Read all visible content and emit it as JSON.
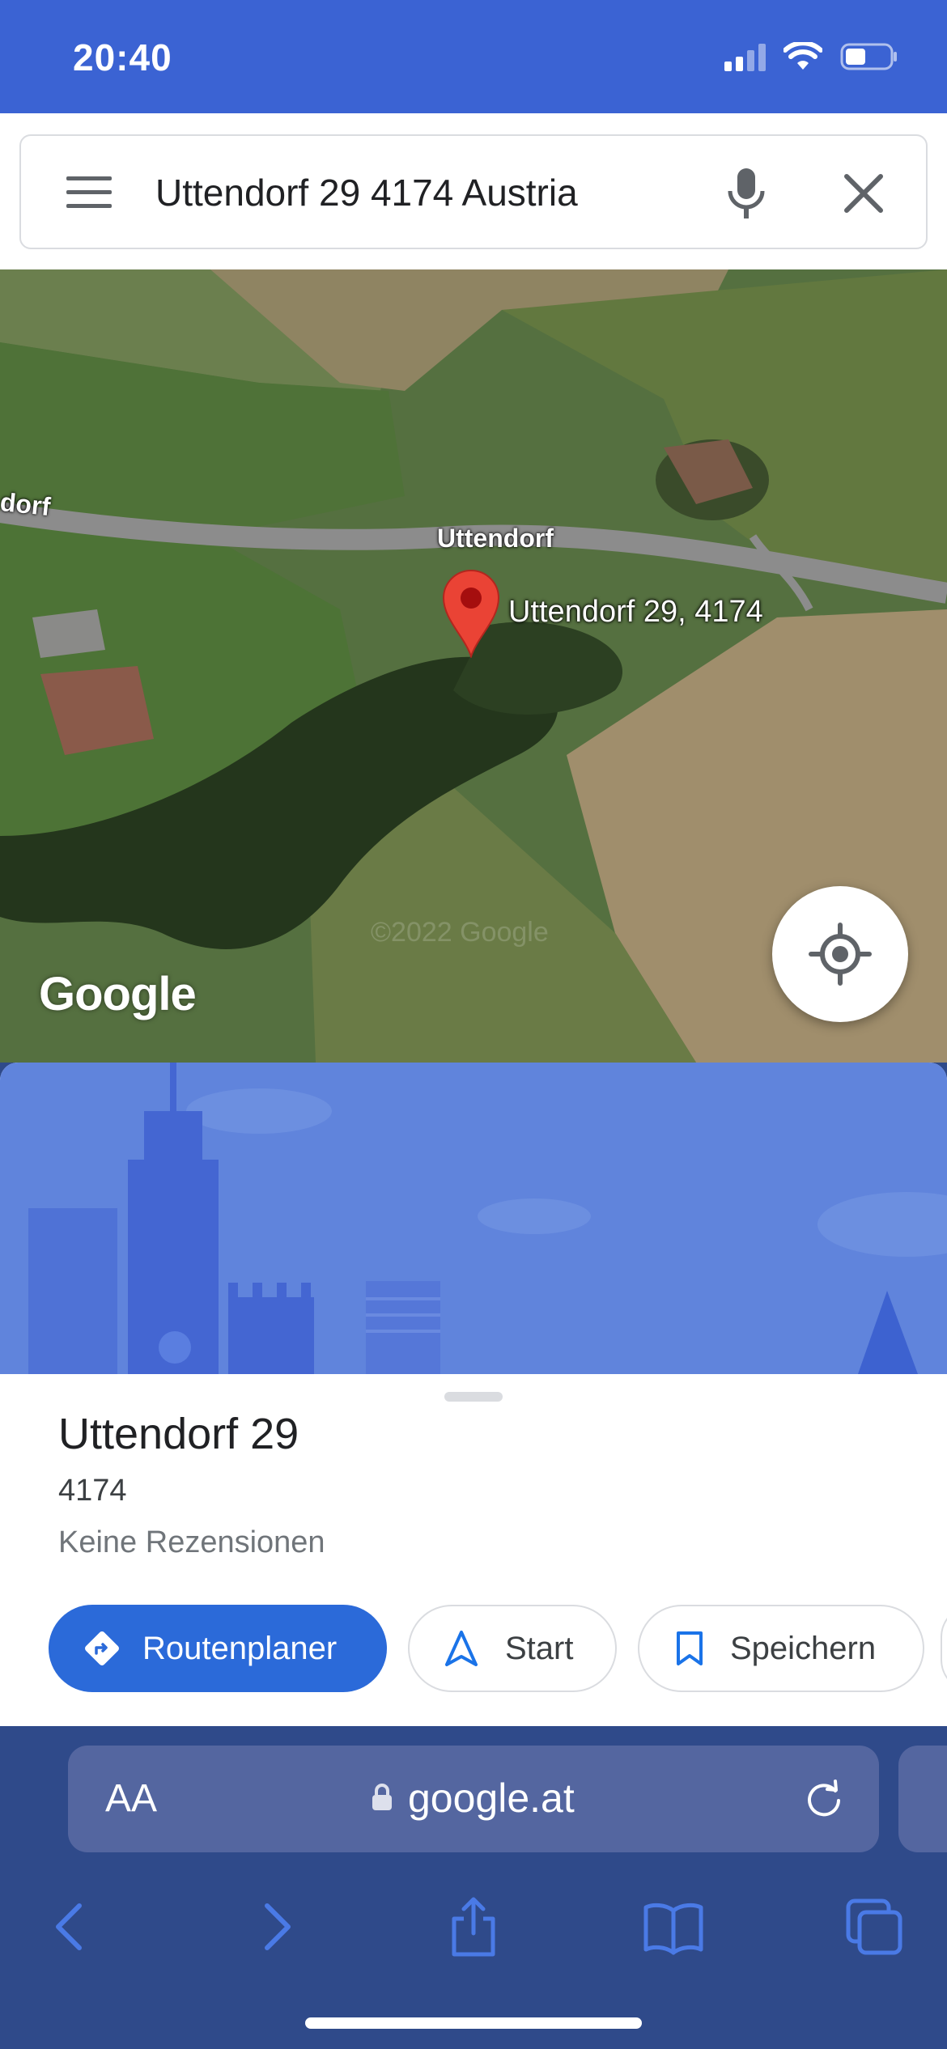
{
  "status_bar": {
    "time": "20:40",
    "icons": [
      "cellular-signal-icon",
      "wifi-icon",
      "battery-icon"
    ]
  },
  "search": {
    "value": "Uttendorf 29 4174 Austria",
    "menu_icon": "hamburger-menu-icon",
    "mic_icon": "microphone-icon",
    "close_icon": "close-icon"
  },
  "map": {
    "road_label_left": "dorf",
    "road_label": "Uttendorf",
    "place_label": "Uttendorf 29, 4174",
    "copyright": "©2022 Google",
    "logo": "Google",
    "locate_icon": "my-location-icon"
  },
  "place": {
    "title": "Uttendorf 29",
    "postal": "4174",
    "reviews": "Keine Rezensionen"
  },
  "actions": {
    "directions": "Routenplaner",
    "start": "Start",
    "save": "Speichern"
  },
  "browser": {
    "text_size": "AA",
    "url": "google.at",
    "toolbar_icons": [
      "back-icon",
      "forward-icon",
      "share-icon",
      "bookmarks-icon",
      "tabs-icon"
    ]
  },
  "colors": {
    "status_bar": "#3b63d3",
    "primary_button": "#2b6ad9",
    "marker": "#ea4335",
    "browser_chrome": "#2f4a8a"
  }
}
